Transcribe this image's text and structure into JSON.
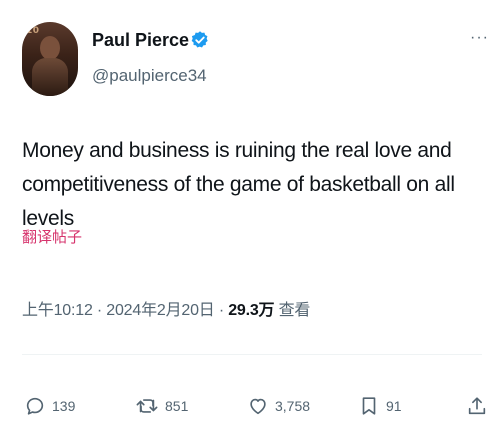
{
  "author": {
    "name": "Paul Pierce",
    "handle": "@paulpierce34",
    "avatar_number": "10"
  },
  "tweet": {
    "text": "Money and business is ruining the real love and competitiveness of the game of basketball on all levels",
    "translate_label": "翻译帖子",
    "time": "上午10:12",
    "date": "2024年2月20日",
    "separator": "·",
    "views_count": "29.3万",
    "views_label": "查看"
  },
  "actions": {
    "replies": "139",
    "retweets": "851",
    "likes": "3,758",
    "bookmarks": "91"
  },
  "icons": {
    "verified": "verified-badge-icon",
    "more": "more-icon",
    "reply": "reply-icon",
    "retweet": "retweet-icon",
    "like": "heart-icon",
    "bookmark": "bookmark-icon",
    "share": "share-icon"
  },
  "colors": {
    "verified_blue": "#1d9bf0",
    "translate_pink": "#d6336c",
    "secondary_text": "#536471",
    "primary_text": "#0f1419"
  }
}
